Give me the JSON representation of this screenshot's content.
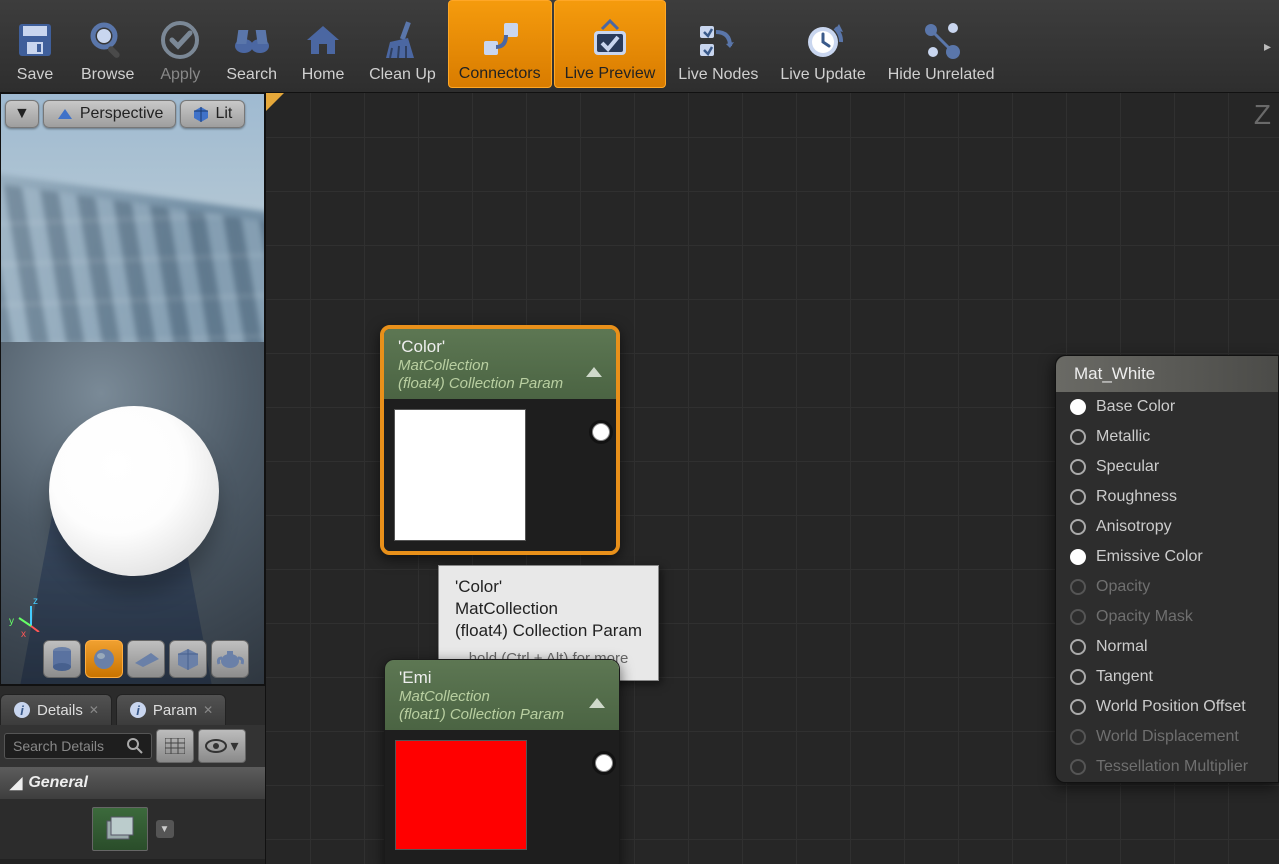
{
  "toolbar": [
    {
      "key": "save",
      "label": "Save",
      "active": false
    },
    {
      "key": "browse",
      "label": "Browse",
      "active": false
    },
    {
      "key": "apply",
      "label": "Apply",
      "active": false,
      "disabled": true
    },
    {
      "key": "search",
      "label": "Search",
      "active": false
    },
    {
      "key": "home",
      "label": "Home",
      "active": false
    },
    {
      "key": "cleanup",
      "label": "Clean Up",
      "active": false
    },
    {
      "key": "connectors",
      "label": "Connectors",
      "active": true
    },
    {
      "key": "livepreview",
      "label": "Live Preview",
      "active": true
    },
    {
      "key": "livenodes",
      "label": "Live Nodes",
      "active": false
    },
    {
      "key": "liveupdate",
      "label": "Live Update",
      "active": false
    },
    {
      "key": "hideunrelated",
      "label": "Hide Unrelated",
      "active": false
    }
  ],
  "viewport": {
    "menu_arrow": "▼",
    "perspective_label": "Perspective",
    "lit_label": "Lit",
    "axis": {
      "x": "x",
      "y": "y",
      "z": "z"
    },
    "corner_letter": "Z"
  },
  "tabs": {
    "details": "Details",
    "params": "Param"
  },
  "search": {
    "placeholder": "Search Details"
  },
  "section": {
    "general": "General"
  },
  "node_color": {
    "title": "'Color'",
    "sub1": "MatCollection",
    "sub2": "(float4) Collection Param",
    "swatch": "#ffffff"
  },
  "node_emi": {
    "title": "'Emi",
    "sub1": "MatCollection",
    "sub2": "(float1) Collection Param",
    "swatch": "#ff0000"
  },
  "tooltip": {
    "l1": "'Color'",
    "l2": "MatCollection",
    "l3": "(float4) Collection Param",
    "hint": "hold (Ctrl + Alt) for more"
  },
  "mat_node": {
    "title": "Mat_White",
    "pins": [
      {
        "label": "Base Color",
        "filled": true,
        "disabled": false
      },
      {
        "label": "Metallic",
        "filled": false,
        "disabled": false
      },
      {
        "label": "Specular",
        "filled": false,
        "disabled": false
      },
      {
        "label": "Roughness",
        "filled": false,
        "disabled": false
      },
      {
        "label": "Anisotropy",
        "filled": false,
        "disabled": false
      },
      {
        "label": "Emissive Color",
        "filled": true,
        "disabled": false
      },
      {
        "label": "Opacity",
        "filled": false,
        "disabled": true
      },
      {
        "label": "Opacity Mask",
        "filled": false,
        "disabled": true
      },
      {
        "label": "Normal",
        "filled": false,
        "disabled": false
      },
      {
        "label": "Tangent",
        "filled": false,
        "disabled": false
      },
      {
        "label": "World Position Offset",
        "filled": false,
        "disabled": false
      },
      {
        "label": "World Displacement",
        "filled": false,
        "disabled": true
      },
      {
        "label": "Tessellation Multiplier",
        "filled": false,
        "disabled": true
      }
    ]
  }
}
